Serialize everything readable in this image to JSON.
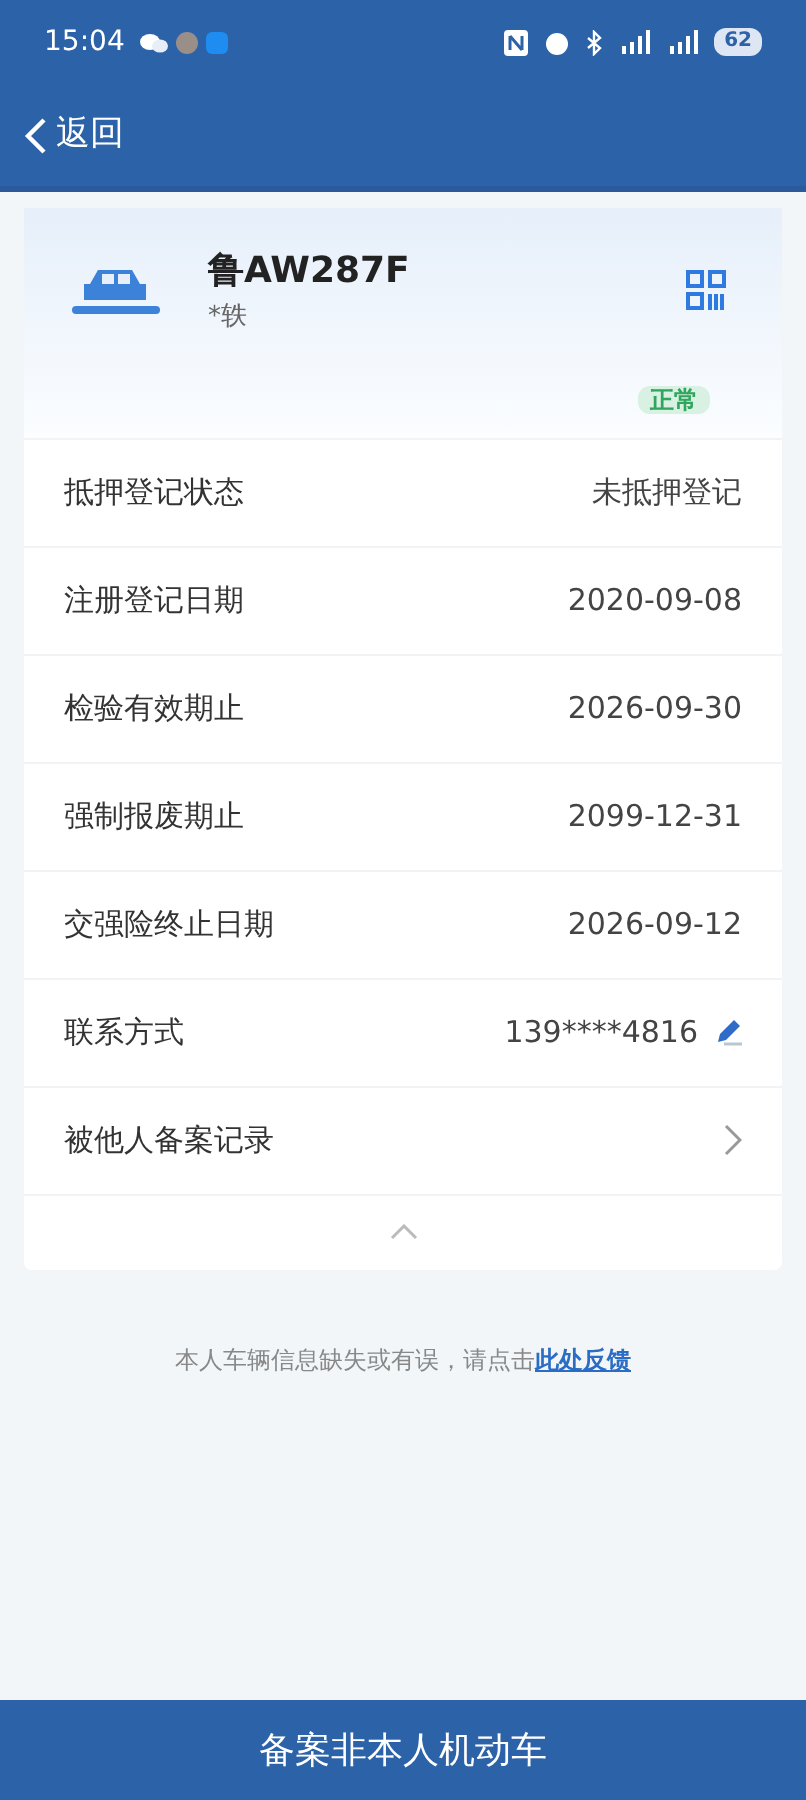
{
  "status_bar": {
    "time": "15:04",
    "battery": "62"
  },
  "nav": {
    "back": "返回"
  },
  "vehicle": {
    "plate": "鲁AW287F",
    "owner": "*轶",
    "status": "正常"
  },
  "rows": [
    {
      "kind": "plain",
      "label": "抵押登记状态",
      "value": "未抵押登记"
    },
    {
      "kind": "plain",
      "label": "注册登记日期",
      "value": "2020-09-08"
    },
    {
      "kind": "plain",
      "label": "检验有效期止",
      "value": "2026-09-30"
    },
    {
      "kind": "plain",
      "label": "强制报废期止",
      "value": "2099-12-31"
    },
    {
      "kind": "plain",
      "label": "交强险终止日期",
      "value": "2026-09-12"
    },
    {
      "kind": "edit",
      "label": "联系方式",
      "value": "139****4816"
    },
    {
      "kind": "link",
      "label": "被他人备案记录"
    }
  ],
  "feedback": {
    "text": "本人车辆信息缺失或有误，请点击",
    "link": "此处反馈"
  },
  "bottom_button": "备案非本人机动车"
}
